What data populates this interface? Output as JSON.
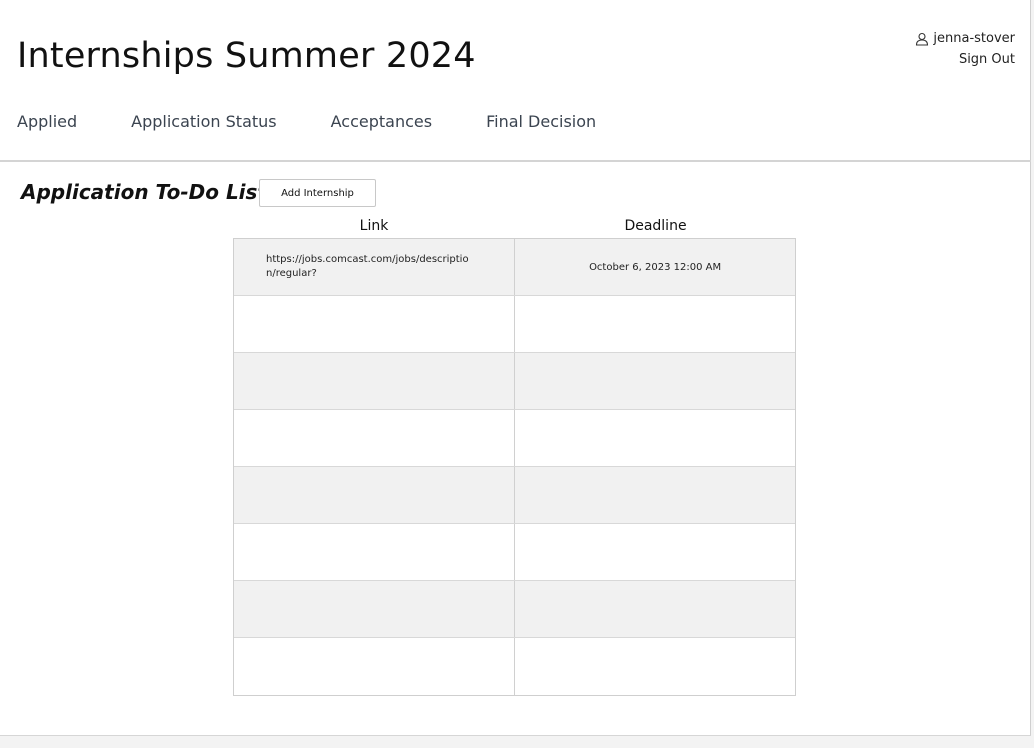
{
  "header": {
    "title": "Internships Summer 2024",
    "username": "jenna-stover",
    "sign_out": "Sign Out"
  },
  "nav": {
    "items": [
      {
        "label": "Applied"
      },
      {
        "label": "Application Status"
      },
      {
        "label": "Acceptances"
      },
      {
        "label": "Final Decision"
      }
    ]
  },
  "todo": {
    "title": "Application To-Do List",
    "add_button": "Add Internship",
    "columns": {
      "link": "Link",
      "deadline": "Deadline"
    },
    "rows": [
      {
        "link": "https://jobs.comcast.com/jobs/description/regular?",
        "deadline": "October 6, 2023 12:00 AM"
      },
      {
        "link": "",
        "deadline": ""
      },
      {
        "link": "",
        "deadline": ""
      },
      {
        "link": "",
        "deadline": ""
      },
      {
        "link": "",
        "deadline": ""
      },
      {
        "link": "",
        "deadline": ""
      },
      {
        "link": "",
        "deadline": ""
      },
      {
        "link": "",
        "deadline": ""
      }
    ]
  },
  "icons": {
    "user": "user-icon"
  }
}
